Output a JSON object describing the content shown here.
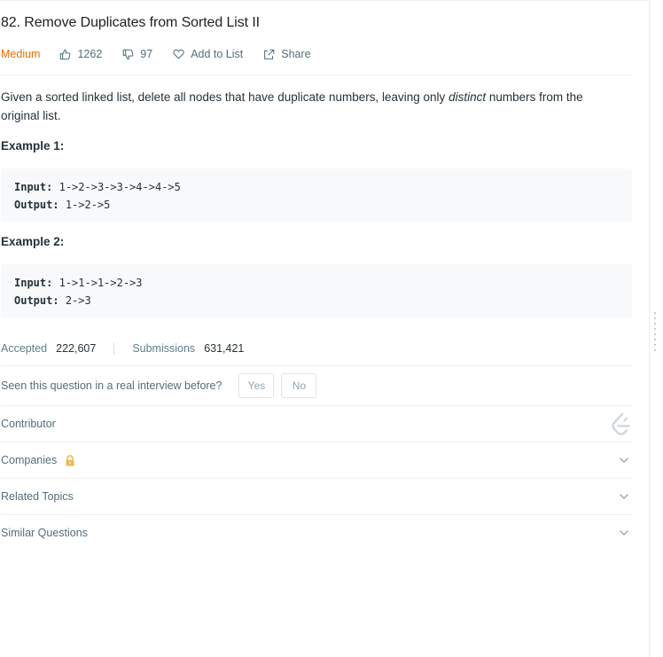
{
  "problem": {
    "title": "82. Remove Duplicates from Sorted List II",
    "difficulty": "Medium",
    "likes": "1262",
    "dislikes": "97",
    "add_to_list_label": "Add to List",
    "share_label": "Share"
  },
  "description": {
    "part1": "Given a sorted linked list, delete all nodes that have duplicate numbers, leaving only ",
    "emphasis": "distinct",
    "part2": " numbers from the original list."
  },
  "examples": [
    {
      "heading": "Example 1:",
      "input_label": "Input:",
      "input": "1->2->3->3->4->4->5",
      "output_label": "Output:",
      "output": "1->2->5"
    },
    {
      "heading": "Example 2:",
      "input_label": "Input:",
      "input": "1->1->1->2->3",
      "output_label": "Output:",
      "output": "2->3"
    }
  ],
  "stats": {
    "accepted_label": "Accepted",
    "accepted_value": "222,607",
    "submissions_label": "Submissions",
    "submissions_value": "631,421"
  },
  "interview": {
    "question": "Seen this question in a real interview before?",
    "yes_label": "Yes",
    "no_label": "No"
  },
  "sections": {
    "contributor": "Contributor",
    "companies": "Companies",
    "related_topics": "Related Topics",
    "similar_questions": "Similar Questions"
  },
  "colors": {
    "difficulty_medium": "#ef6c00",
    "lock": "#f0b64a",
    "code_bg": "#f7f9fa",
    "divider": "#eeeeee"
  },
  "icons": [
    "thumbs-up-icon",
    "thumbs-down-icon",
    "heart-icon",
    "share-icon",
    "lock-icon",
    "chevron-down-icon",
    "contributor-logo-icon"
  ]
}
